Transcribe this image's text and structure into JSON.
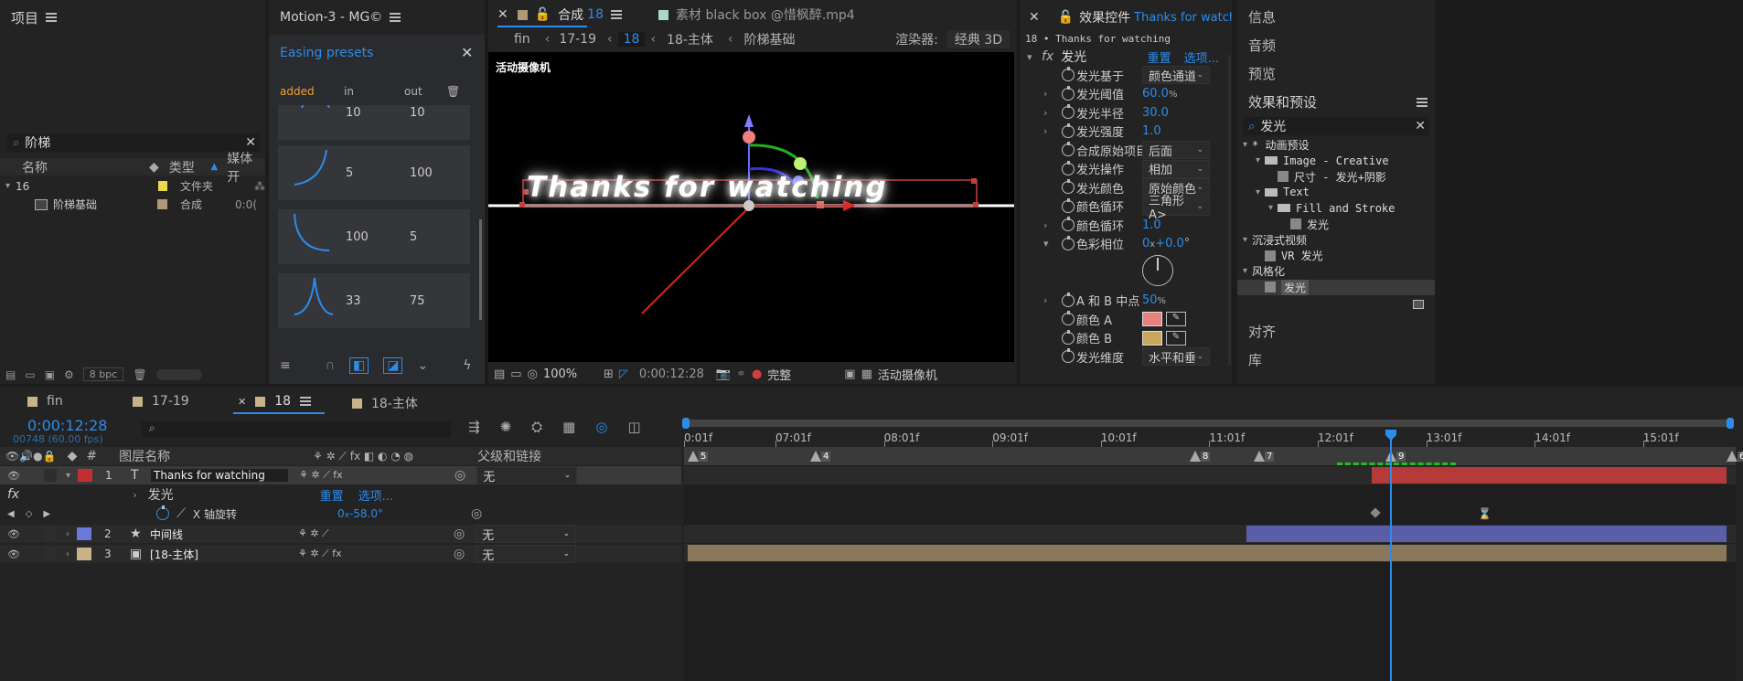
{
  "project": {
    "title": "项目",
    "search": "阶梯",
    "col_name": "名称",
    "col_type": "类型",
    "col_media": "媒体开",
    "items": [
      {
        "name": "16",
        "type": "文件夹",
        "extra": ""
      },
      {
        "name": "阶梯基础",
        "type": "合成",
        "extra": "0:0("
      }
    ],
    "bpc": "8 bpc"
  },
  "motion": {
    "title": "Motion-3 - MG©",
    "easing_title": "Easing presets",
    "tab_added": "added",
    "tab_in": "in",
    "tab_out": "out",
    "presets": [
      {
        "in": "10",
        "out": "10"
      },
      {
        "in": "5",
        "out": "100"
      },
      {
        "in": "100",
        "out": "5"
      },
      {
        "in": "33",
        "out": "75"
      }
    ]
  },
  "comp": {
    "tab_active": "合成",
    "tab_active_num": "18",
    "tab_footage": "素材 black box @惜枫醉.mp4",
    "crumbs": [
      "fin",
      "17-19",
      "18",
      "18-主体",
      "阶梯基础"
    ],
    "renderer_label": "渲染器:",
    "renderer": "经典 3D",
    "camera_label": "活动摄像机",
    "text": "Thanks for watching",
    "zoom": "100%",
    "timecode": "0:00:12:28",
    "quality": "完整",
    "camera": "活动摄像机"
  },
  "effects": {
    "title": "效果控件",
    "layer_name": "Thanks for watch",
    "breadcrumb": "18 • Thanks for watching",
    "fx_name": "发光",
    "reset": "重置",
    "options": "选项...",
    "props": [
      {
        "name": "发光基于",
        "value": "颜色通道",
        "type": "dd"
      },
      {
        "name": "发光阈值",
        "value": "60.0",
        "unit": "%",
        "type": "num"
      },
      {
        "name": "发光半径",
        "value": "30.0",
        "type": "num"
      },
      {
        "name": "发光强度",
        "value": "1.0",
        "type": "num"
      },
      {
        "name": "合成原始项目",
        "value": "后面",
        "type": "dd"
      },
      {
        "name": "发光操作",
        "value": "相加",
        "type": "dd"
      },
      {
        "name": "发光颜色",
        "value": "原始颜色",
        "type": "dd"
      },
      {
        "name": "颜色循环",
        "value": "三角形 A>",
        "type": "dd"
      },
      {
        "name": "颜色循环",
        "value": "1.0",
        "type": "num"
      },
      {
        "name": "色彩相位",
        "value": "0",
        "unit": "x",
        "value2": "+0.0",
        "unit2": "°",
        "type": "num"
      },
      {
        "name": "A 和 B 中点",
        "value": "50",
        "unit": "%",
        "type": "num"
      },
      {
        "name": "颜色 A",
        "type": "color",
        "color": "#e88080"
      },
      {
        "name": "颜色 B",
        "type": "color",
        "color": "#c8a858"
      },
      {
        "name": "发光维度",
        "value": "水平和垂",
        "type": "dd"
      }
    ]
  },
  "right": {
    "items1": [
      "信息",
      "音频",
      "预览"
    ],
    "fx_title": "效果和预设",
    "search": "发光",
    "tree": [
      {
        "label": "* 动画预设",
        "indent": 0
      },
      {
        "label": "Image - Creative",
        "indent": 1,
        "folder": true
      },
      {
        "label": "尺寸 - 发光+阴影",
        "indent": 2,
        "file": true
      },
      {
        "label": "Text",
        "indent": 1,
        "folder": true
      },
      {
        "label": "Fill and Stroke",
        "indent": 2,
        "folder": true
      },
      {
        "label": "发光",
        "indent": 3,
        "file": true
      },
      {
        "label": "沉浸式视频",
        "indent": 0
      },
      {
        "label": "VR 发光",
        "indent": 1,
        "file": true
      },
      {
        "label": "风格化",
        "indent": 0
      },
      {
        "label": "发光",
        "indent": 1,
        "file": true,
        "selected": true
      }
    ],
    "items2": [
      "对齐",
      "库"
    ]
  },
  "timeline": {
    "tabs": [
      "fin",
      "17-19",
      "18",
      "18-主体"
    ],
    "timecode": "0:00:12:28",
    "frames": "00748 (60.00 fps)",
    "col_layer": "图层名称",
    "col_parent": "父级和链接",
    "ruler": [
      "0:01f",
      "07:01f",
      "08:01f",
      "09:01f",
      "10:01f",
      "11:01f",
      "12:01f",
      "13:01f",
      "14:01f",
      "15:01f"
    ],
    "markers": [
      "5",
      "4",
      "8",
      "7",
      "9",
      "6"
    ],
    "layers": [
      {
        "num": "1",
        "name": "Thanks for watching",
        "parent": "无",
        "color": "#c03030"
      },
      {
        "num": "2",
        "name": "中间线",
        "parent": "无",
        "color": "#6b7ad8"
      },
      {
        "num": "3",
        "name": "[18-主体]",
        "parent": "无",
        "color": "#c8b28a"
      }
    ],
    "fx_label": "发光",
    "fx_reset": "重置",
    "fx_options": "选项...",
    "rot_label": "X 轴旋转",
    "rot_value": "0",
    "rot_x": "x",
    "rot_deg": "-58.0",
    "rot_unit": "°"
  }
}
